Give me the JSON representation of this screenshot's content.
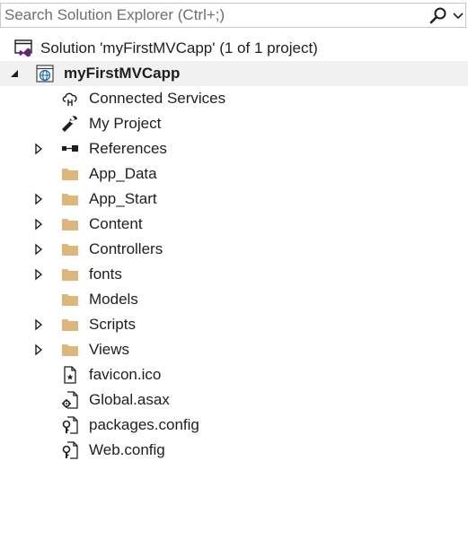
{
  "search": {
    "placeholder": "Search Solution Explorer (Ctrl+;)",
    "search_icon": "magnifier-icon",
    "dropdown_icon": "dropdown-arrow-icon"
  },
  "tree": {
    "solution": {
      "label": "Solution 'myFirstMVCapp' (1 of 1 project)",
      "icon": "solution-icon"
    },
    "project": {
      "label": "myFirstMVCapp",
      "icon": "web-project-icon",
      "expanded": true
    },
    "items": [
      {
        "label": "Connected Services",
        "icon": "connected-services-icon",
        "expandable": false
      },
      {
        "label": "My Project",
        "icon": "wrench-icon",
        "expandable": false
      },
      {
        "label": "References",
        "icon": "references-icon",
        "expandable": true
      },
      {
        "label": "App_Data",
        "icon": "folder-icon",
        "expandable": false
      },
      {
        "label": "App_Start",
        "icon": "folder-icon",
        "expandable": true
      },
      {
        "label": "Content",
        "icon": "folder-icon",
        "expandable": true
      },
      {
        "label": "Controllers",
        "icon": "folder-icon",
        "expandable": true
      },
      {
        "label": "fonts",
        "icon": "folder-icon",
        "expandable": true
      },
      {
        "label": "Models",
        "icon": "folder-icon",
        "expandable": false
      },
      {
        "label": "Scripts",
        "icon": "folder-icon",
        "expandable": true
      },
      {
        "label": "Views",
        "icon": "folder-icon",
        "expandable": true
      },
      {
        "label": "favicon.ico",
        "icon": "icon-file-icon",
        "expandable": false
      },
      {
        "label": "Global.asax",
        "icon": "global-asax-file-icon",
        "expandable": false
      },
      {
        "label": "packages.config",
        "icon": "config-file-icon",
        "expandable": false
      },
      {
        "label": "Web.config",
        "icon": "config-file-icon",
        "expandable": false
      }
    ]
  },
  "colors": {
    "folder": "#dcb67a",
    "selection_bg": "#f1f1f1",
    "text": "#1e1e1e",
    "placeholder": "#6f6f6f",
    "vs_purple": "#68217a",
    "globe_blue": "#1e6ab4"
  }
}
